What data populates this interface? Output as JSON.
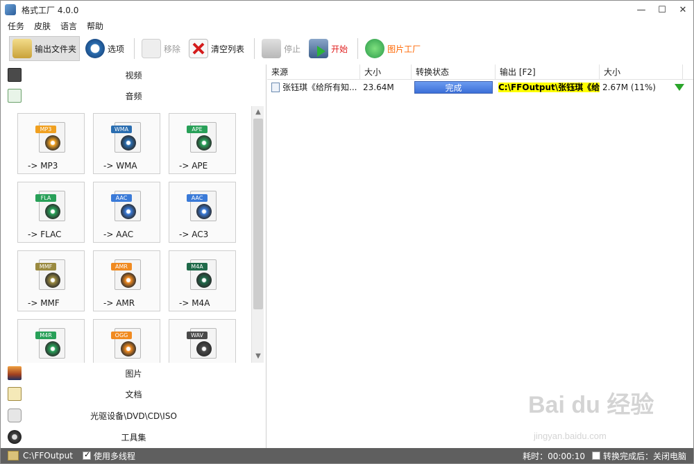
{
  "window": {
    "title": "格式工厂 4.0.0",
    "controls": [
      "—",
      "☐",
      "✕"
    ]
  },
  "menu": [
    "任务",
    "皮肤",
    "语言",
    "帮助"
  ],
  "toolbar": {
    "output_folder": "输出文件夹",
    "options": "选项",
    "remove": "移除",
    "clear_list": "清空列表",
    "stop": "停止",
    "start": "开始",
    "picture_factory": "图片工厂"
  },
  "categories": {
    "video": "视频",
    "audio": "音频",
    "picture": "图片",
    "document": "文档",
    "rom_device": "光驱设备\\DVD\\CD\\ISO",
    "toolkit": "工具集"
  },
  "formats": [
    {
      "tag": "MP3",
      "label": "-> MP3",
      "color": "#f0a020"
    },
    {
      "tag": "WMA",
      "label": "-> WMA",
      "color": "#2a6db0"
    },
    {
      "tag": "APE",
      "label": "-> APE",
      "color": "#28a058"
    },
    {
      "tag": "FLA",
      "label": "-> FLAC",
      "color": "#28a058"
    },
    {
      "tag": "AAC",
      "label": "-> AAC",
      "color": "#3a7ad8"
    },
    {
      "tag": "AAC",
      "label": "-> AC3",
      "color": "#3a7ad8"
    },
    {
      "tag": "MMF",
      "label": "-> MMF",
      "color": "#9a8a40"
    },
    {
      "tag": "AMR",
      "label": "-> AMR",
      "color": "#f08a20"
    },
    {
      "tag": "M4A",
      "label": "-> M4A",
      "color": "#1f6a4a"
    },
    {
      "tag": "M4R",
      "label": "",
      "color": "#28a058"
    },
    {
      "tag": "OGG",
      "label": "",
      "color": "#f08a20"
    },
    {
      "tag": "WAV",
      "label": "",
      "color": "#4a4a4a"
    }
  ],
  "table": {
    "headers": [
      "来源",
      "大小",
      "转换状态",
      "输出 [F2]",
      "大小"
    ],
    "rows": [
      {
        "source": "张钰琪《给所有知...",
        "size": "23.64M",
        "status": "完成",
        "output": "C:\\FFOutput\\张钰琪《给...",
        "out_size": "2.67M  (11%)"
      }
    ]
  },
  "statusbar": {
    "output_path": "C:\\FFOutput",
    "multithread_label": "使用多线程",
    "multithread_checked": true,
    "elapsed": "耗时：00:00:10",
    "after_convert": "转换完成后：关闭电脑"
  },
  "watermark": {
    "main": "Bai du 经验",
    "sub": "jingyan.baidu.com"
  }
}
